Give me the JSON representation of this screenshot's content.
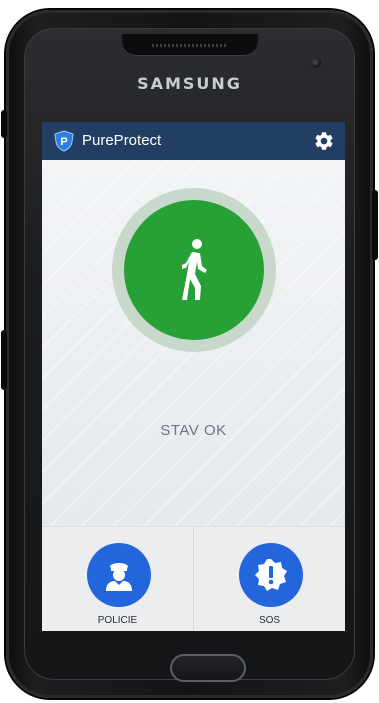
{
  "device": {
    "brand": "SAMSUNG"
  },
  "app_bar": {
    "title": "PureProtect",
    "logo_letter": "P",
    "logo_icon": "shield-logo",
    "settings_icon": "gear-icon",
    "background_color": "#223e63"
  },
  "status": {
    "text": "STAV OK",
    "icon": "walking-person-icon",
    "indicator_color": "#27a135"
  },
  "actions": [
    {
      "label": "POLICIE",
      "icon": "police-officer-icon",
      "color": "#2366db"
    },
    {
      "label": "SOS",
      "icon": "alert-badge-icon",
      "color": "#2366db"
    }
  ]
}
